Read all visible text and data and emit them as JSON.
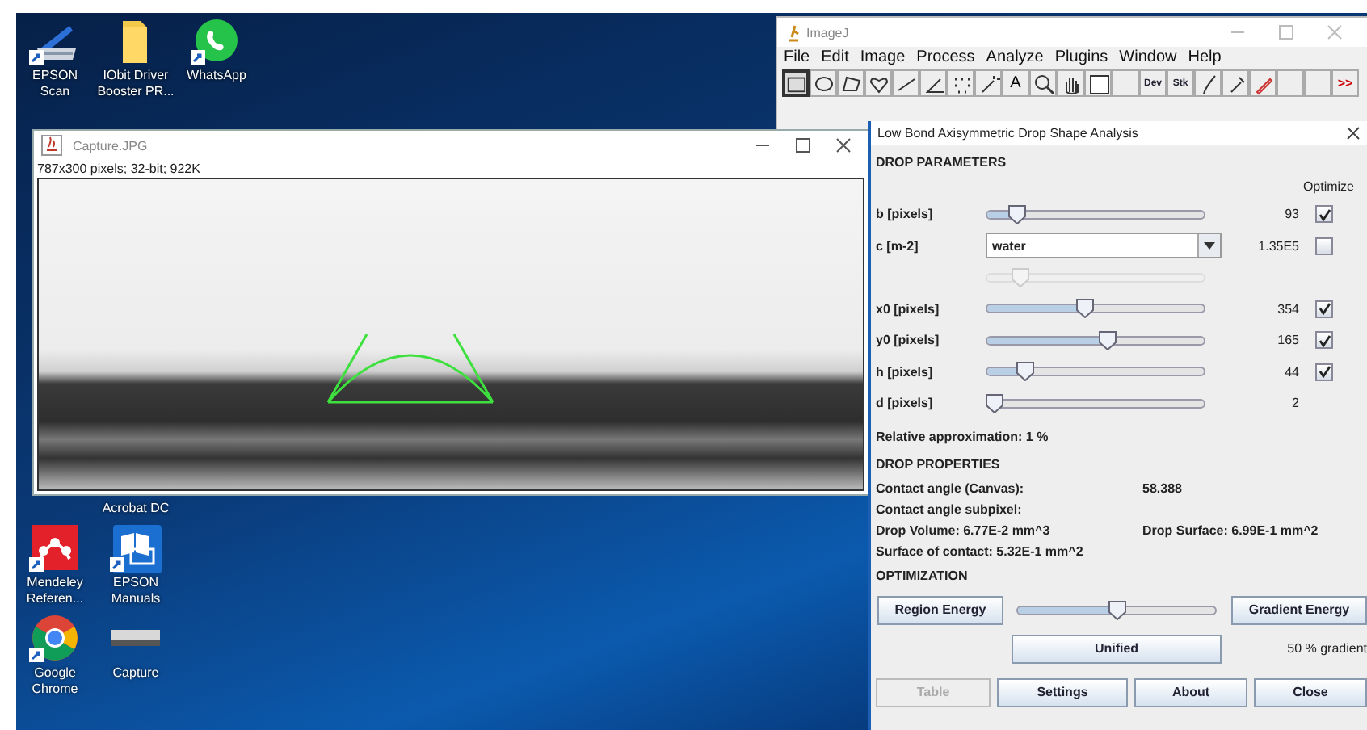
{
  "desktop": {
    "icons_top": [
      {
        "label": "EPSON Scan",
        "kind": "scanner",
        "shortcut": true
      },
      {
        "label": "IObit Driver Booster PR...",
        "kind": "folder",
        "shortcut": false
      },
      {
        "label": "WhatsApp",
        "kind": "chat",
        "shortcut": true
      }
    ],
    "icons_bottom": [
      {
        "label": "Acrobat DC",
        "kind": "covered"
      },
      {
        "label": "Mendeley Referen...",
        "kind": "mendeley",
        "shortcut": true
      },
      {
        "label": "EPSON Manuals",
        "kind": "manuals",
        "shortcut": true
      },
      {
        "label": "Google Chrome",
        "kind": "browser",
        "shortcut": true
      },
      {
        "label": "Capture",
        "kind": "picture",
        "shortcut": false
      }
    ]
  },
  "image_window": {
    "title": "Capture.JPG",
    "info": "787x300 pixels; 32-bit; 922K"
  },
  "imagej": {
    "title": "ImageJ",
    "menu": [
      "File",
      "Edit",
      "Image",
      "Process",
      "Analyze",
      "Plugins",
      "Window",
      "Help"
    ],
    "tools": [
      {
        "kind": "rectangle",
        "selected": true
      },
      {
        "kind": "oval",
        "selected": false
      },
      {
        "kind": "polygon",
        "selected": false
      },
      {
        "kind": "freehand",
        "selected": false
      },
      {
        "kind": "line",
        "selected": false
      },
      {
        "kind": "angle",
        "selected": false
      },
      {
        "kind": "point",
        "selected": false
      },
      {
        "kind": "wand",
        "selected": false
      },
      {
        "kind": "text",
        "label": "A",
        "selected": false
      },
      {
        "kind": "zoom",
        "selected": false
      },
      {
        "kind": "hand",
        "selected": false
      },
      {
        "kind": "color",
        "selected": false
      },
      {
        "kind": "blank",
        "selected": false
      },
      {
        "kind": "macro",
        "label": "Dev",
        "selected": false
      },
      {
        "kind": "macro",
        "label": "Stk",
        "selected": false
      },
      {
        "kind": "brush",
        "selected": false
      },
      {
        "kind": "dropper",
        "selected": false
      },
      {
        "kind": "pencil",
        "selected": false
      },
      {
        "kind": "blank",
        "selected": false
      },
      {
        "kind": "blank",
        "selected": false
      },
      {
        "kind": "more",
        "label": ">>",
        "selected": false
      }
    ]
  },
  "dialog": {
    "title": "Low Bond Axisymmetric Drop Shape Analysis",
    "params_heading": "DROP PARAMETERS",
    "optimize_label": "Optimize",
    "params": [
      {
        "label": "b [pixels]",
        "kind": "slider",
        "level": 0.11,
        "reading": "93",
        "checked": true
      },
      {
        "label": "c [m-2]",
        "kind": "dropdown",
        "value": "water",
        "reading": "1.35E5",
        "checked": false,
        "level": 0.13,
        "slider_disabled": true
      },
      {
        "label": "x0 [pixels]",
        "kind": "slider",
        "level": 0.45,
        "reading": "354",
        "checked": true
      },
      {
        "label": "y0 [pixels]",
        "kind": "slider",
        "level": 0.56,
        "reading": "165",
        "checked": true
      },
      {
        "label": "h [pixels]",
        "kind": "slider",
        "level": 0.15,
        "reading": "44",
        "checked": true
      },
      {
        "label": "d [pixels]",
        "kind": "slider",
        "level": 0.0,
        "reading": "2"
      }
    ],
    "approximation": "Relative approximation: 1 %",
    "properties_heading": "DROP PROPERTIES",
    "properties": [
      [
        "Contact angle (Canvas):",
        "58.388"
      ],
      [
        "Contact angle subpixel:"
      ],
      [
        "Drop Volume: 6.77E-2 mm^3",
        "Drop Surface: 6.99E-1 mm^2"
      ],
      [
        "Surface of contact: 5.32E-1 mm^2"
      ]
    ],
    "optimization_heading": "OPTIMIZATION",
    "region_button": "Region Energy",
    "gradient_button": "Gradient Energy",
    "optimization": {
      "level": 0.5
    },
    "unified_button": "Unified",
    "gradient_share": "50 % gradient",
    "buttons": [
      {
        "label": "Table",
        "disabled": true
      },
      {
        "label": "Settings",
        "disabled": false
      },
      {
        "label": "About",
        "disabled": false
      },
      {
        "label": "Close",
        "disabled": false
      }
    ]
  }
}
